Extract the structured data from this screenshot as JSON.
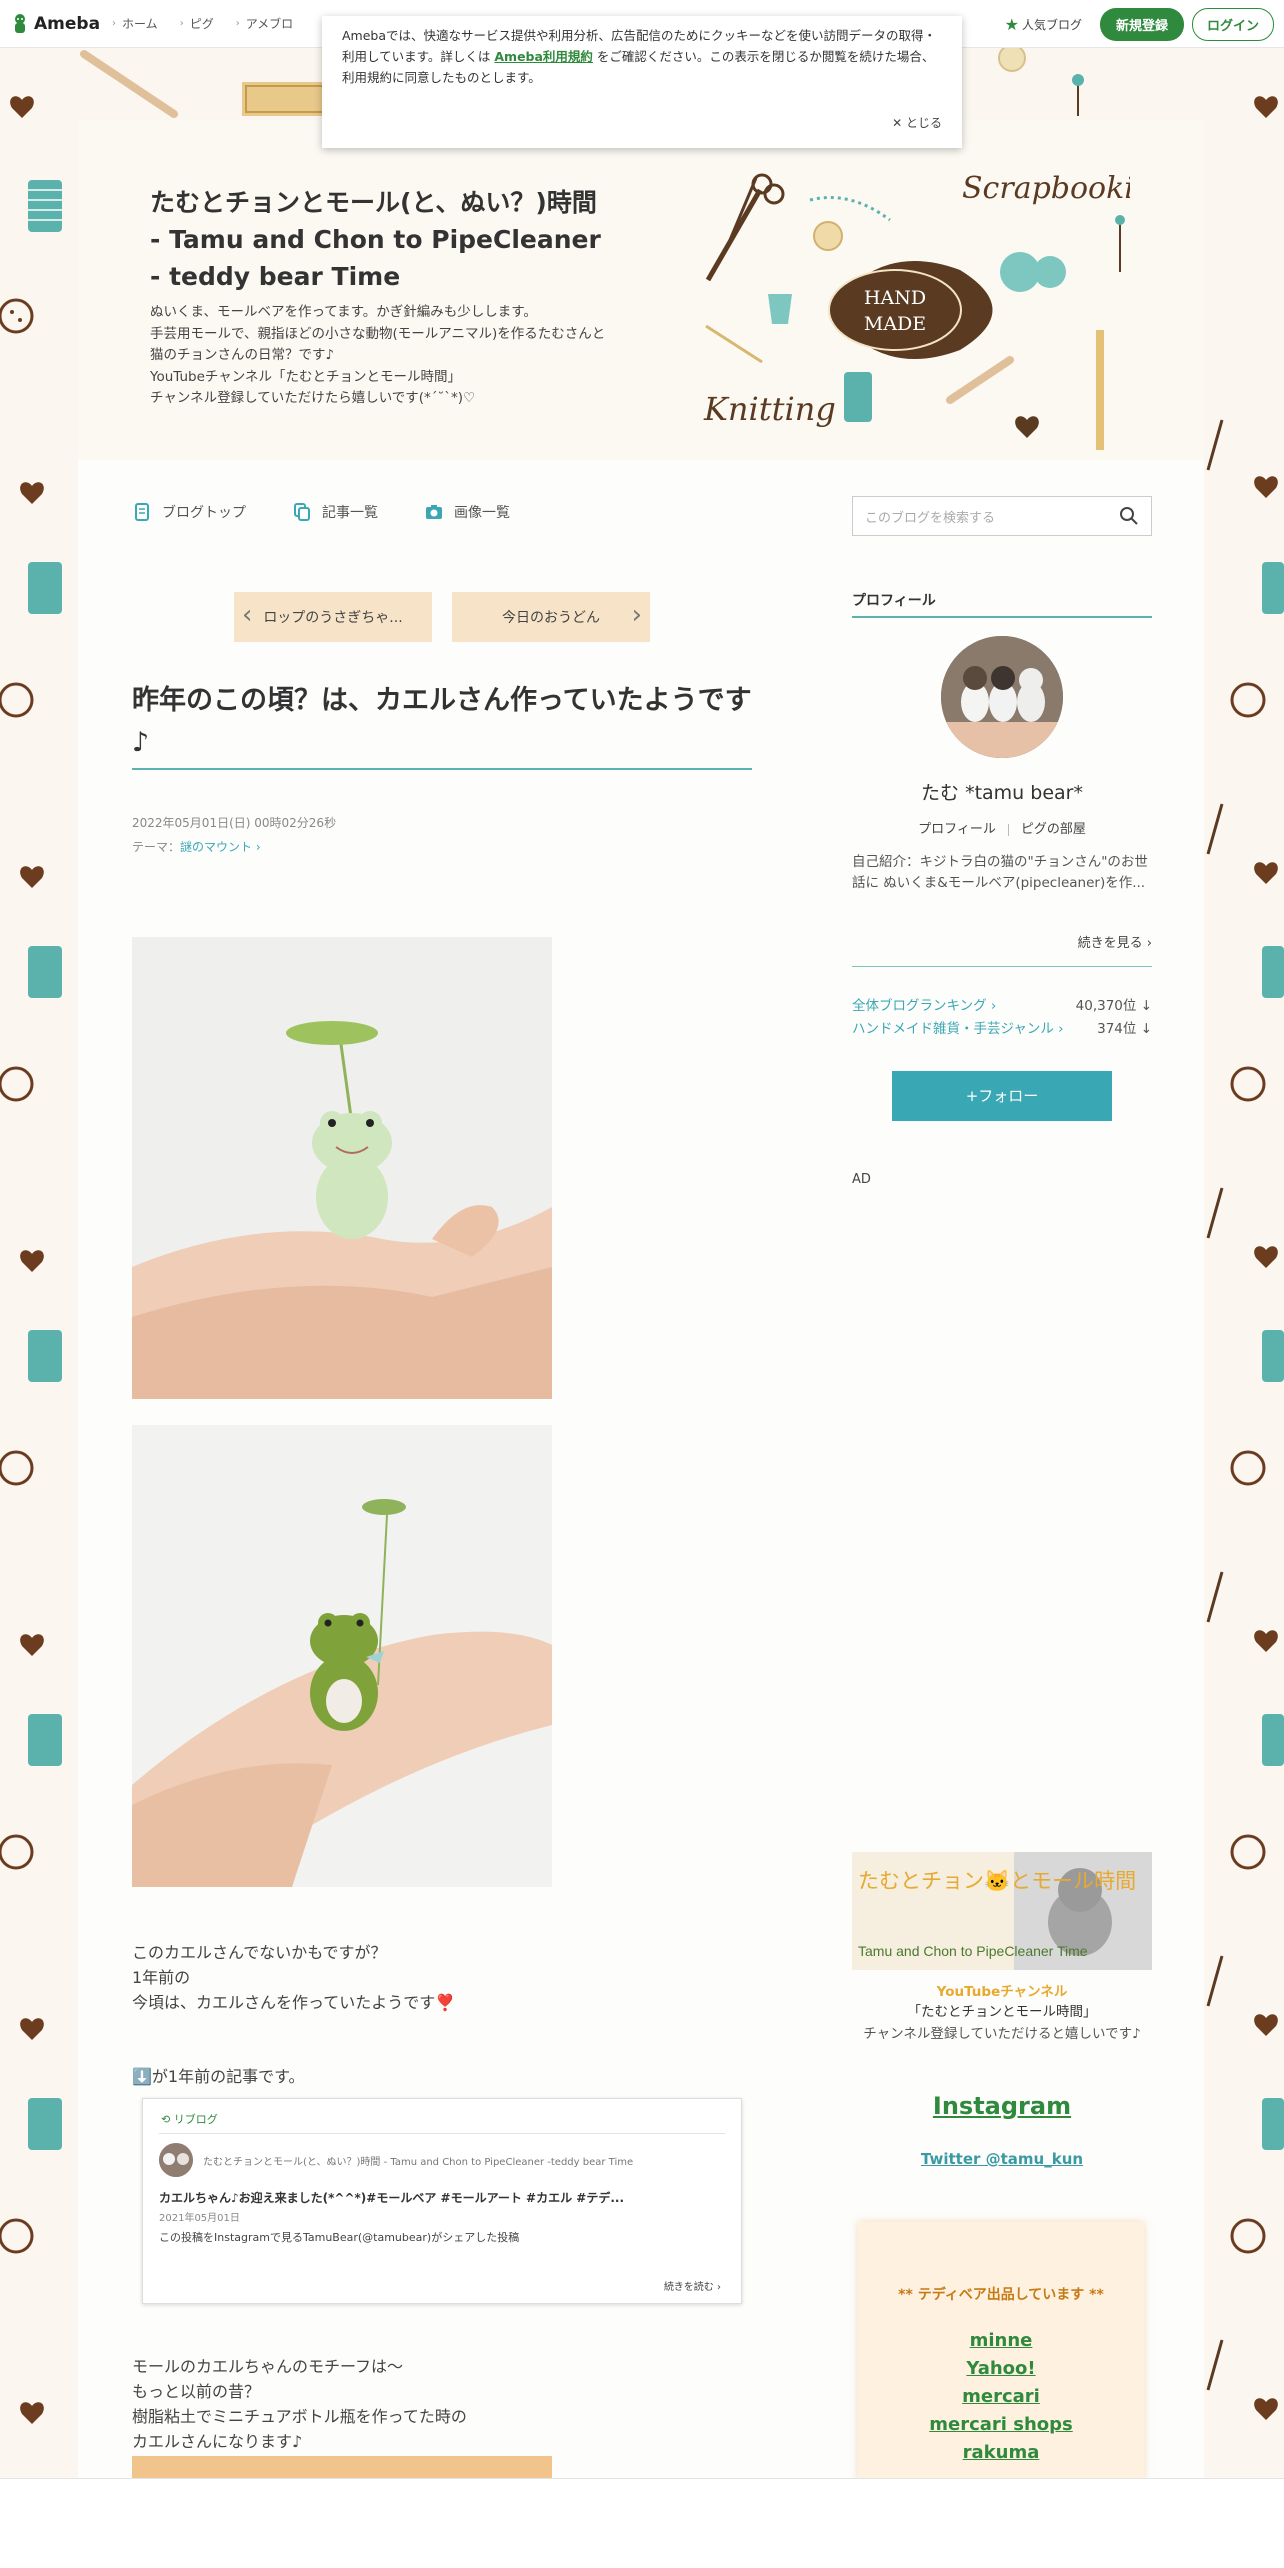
{
  "topbar": {
    "logo": "Ameba",
    "nav": [
      "ホーム",
      "ピグ",
      "アメブロ"
    ],
    "popular": "人気ブログ",
    "register": "新規登録",
    "login": "ログイン"
  },
  "cookie": {
    "text1": "Amebaでは、快適なサービス提供や利用分析、広告配信のためにクッキーなどを使い訪問データの取得・利用しています。詳しくは",
    "link": "Ameba利用規約",
    "text2": "をご確認ください。この表示を閉じるか閲覧を続けた場合、利用規約に同意したものとします。",
    "close": "とじる"
  },
  "blog": {
    "title": "たむとチョンとモール(と、ぬい？)時間 - Tamu and Chon to PipeCleaner - teddy bear Time",
    "desc": [
      "ぬいくま、モールベアを作ってます。かぎ針編みも少しします。",
      "手芸用モールで、親指ほどの小さな動物(モールアニマル)を作るたむさんと猫のチョンさんの日常？です♪",
      "YouTubeチャンネル「たむとチョンとモール時間」",
      "チャンネル登録していただけたら嬉しいです(*´˘`*)♡"
    ],
    "header_art": {
      "script1": "Scrapbooking",
      "badge1": "HAND",
      "badge2": "MADE",
      "script2": "Knitting"
    }
  },
  "nav": {
    "top": "ブログトップ",
    "list": "記事一覧",
    "images": "画像一覧"
  },
  "search": {
    "placeholder": "このブログを検索する"
  },
  "pager": {
    "prev": "ロップのうさぎちゃ...",
    "next": "今日のおうどん"
  },
  "article": {
    "title": "昨年のこの頃？は、カエルさん作っていたようです♪",
    "date": "2022年05月01日(日) 00時02分26秒",
    "theme_label": "テーマ：",
    "theme": "謎のマウント",
    "para1": [
      "このカエルさんでないかもですが？",
      "1年前の",
      "今頃は、カエルさんを作っていたようです❣️"
    ],
    "para2": "⬇️が1年前の記事です。",
    "embed": {
      "label": "リブログ",
      "blog": "たむとチョンとモール(と、ぬい？)時間 - Tamu and Chon to PipeCleaner -teddy bear Time",
      "title": "カエルちゃん♪お迎え来ました(*^^*)#モールベア #モールアート #カエル #テデ...",
      "date": "2021年05月01日",
      "excerpt": "この投稿をInstagramで見るTamuBear(@tamubear)がシェアした投稿",
      "more": "続きを読む"
    },
    "para3": [
      "モールのカエルちゃんのモチーフは〜",
      "もっと以前の昔？",
      "樹脂粘土でミニチュアボトル瓶を作ってた時の",
      "カエルさんになります♪"
    ]
  },
  "sidebar": {
    "profile_head": "プロフィール",
    "name": "たむ *tamu bear*",
    "link_profile": "プロフィール",
    "link_room": "ピグの部屋",
    "intro": "自己紹介：キジトラ白の猫の\"チョンさん\"のお世話に ぬいくま&モールベア(pipecleaner)を作...",
    "more": "続きを見る",
    "rank1_label": "全体ブログランキング",
    "rank1_value": "40,370位",
    "rank2_label": "ハンドメイド雑貨・手芸ジャンル",
    "rank2_value": "374位",
    "follow": "+フォロー",
    "ad": "AD",
    "yt_banner_jp": "たむとチョン🐱とモール時間",
    "yt_banner_en": "Tamu and Chon to PipeCleaner Time",
    "yt_title": "YouTubeチャンネル",
    "yt_name": "「たむとチョンとモール時間」",
    "yt_sub": "チャンネル登録していただけると嬉しいです♪",
    "instagram": "Instagram",
    "twitter": "Twitter @tamu_kun",
    "shop_head": "** テディベア出品しています **",
    "shops": [
      "minne",
      "Yahoo!",
      "mercari",
      "mercari shops",
      "rakuma"
    ]
  },
  "colors": {
    "brand": "#2f8a3d",
    "teal": "#3aa8b4",
    "rule": "#5bb2ac",
    "pager": "#f7e4c8",
    "brown": "#5b3a22"
  }
}
